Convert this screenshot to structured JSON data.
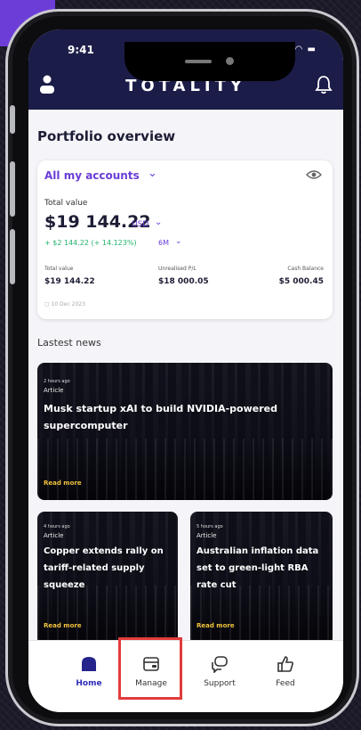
{
  "status": {
    "time": "9:41"
  },
  "header": {
    "brand": "TOTALITY",
    "icons": {
      "left": "user-icon",
      "right": "bell-icon"
    }
  },
  "portfolio": {
    "title": "Portfolio overview",
    "account_selector": "All my accounts",
    "total_value_label": "Total value",
    "total_value": "$19 144.22",
    "currency": "USD",
    "gain": "+ $2 144.22 (+ 14.123%)",
    "gain_period": "6M",
    "stats": [
      {
        "label": "Total value",
        "value": "$19 144.22"
      },
      {
        "label": "Unrealised P/L",
        "value": "$18 000.05"
      },
      {
        "label": "Cash Balance",
        "value": "$5 000.45"
      }
    ],
    "date": "10 Dec 2023"
  },
  "news": {
    "title": "Lastest news",
    "items": [
      {
        "time": "2 hours ago",
        "category": "Article",
        "headline": "Musk startup xAI to build NVIDIA-powered supercomputer",
        "cta": "Read more"
      },
      {
        "time": "4 hours ago",
        "category": "Article",
        "headline": "Copper extends rally on tariff-related supply squeeze",
        "cta": "Read more"
      },
      {
        "time": "5 hours ago",
        "category": "Article",
        "headline": "Australian inflation data set to green-light RBA rate cut",
        "cta": "Read more"
      }
    ]
  },
  "nav": {
    "items": [
      {
        "label": "Home",
        "icon": "home-icon",
        "active": true
      },
      {
        "label": "Manage",
        "icon": "wallet-icon",
        "active": false
      },
      {
        "label": "Support",
        "icon": "chat-icon",
        "active": false
      },
      {
        "label": "Feed",
        "icon": "thumbs-up-icon",
        "active": false
      }
    ]
  },
  "colors": {
    "header": "#1b1c48",
    "accent": "#6a3dd6",
    "gain": "#22b36b",
    "read_more": "#f0c23c",
    "highlight": "#e23b3b"
  }
}
